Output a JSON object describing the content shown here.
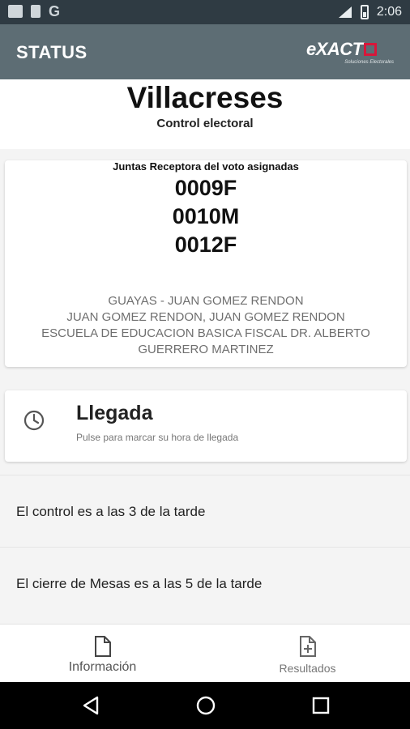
{
  "status_bar": {
    "time": "2:06",
    "g_label": "G"
  },
  "app_bar": {
    "title": "STATUS",
    "logo_text": "eXACT",
    "logo_tagline": "Soluciones Electorales"
  },
  "header": {
    "name": "Villacreses",
    "subtitle": "Control electoral"
  },
  "juntas": {
    "label": "Juntas Receptora del voto asignadas",
    "codes": [
      "0009F",
      "0010M",
      "0012F"
    ],
    "location_lines": [
      "GUAYAS - JUAN GOMEZ RENDON",
      "JUAN GOMEZ RENDON, JUAN GOMEZ RENDON",
      "ESCUELA DE EDUCACION BASICA FISCAL DR. ALBERTO",
      "GUERRERO MARTINEZ"
    ]
  },
  "llegada": {
    "title": "Llegada",
    "subtitle": "Pulse para marcar su hora de llegada",
    "icon": "clock-icon"
  },
  "info_rows": [
    "El control es a las 3 de la tarde",
    "El cierre de Mesas es a las 5 de la tarde"
  ],
  "bottom_nav": [
    {
      "label": "Información",
      "icon": "document-icon",
      "active": true
    },
    {
      "label": "Resultados",
      "icon": "document-add-icon",
      "active": false
    }
  ],
  "colors": {
    "app_bar": "#5d6d74",
    "status_bar": "#2f3b43",
    "logo_accent": "#d8163a"
  }
}
